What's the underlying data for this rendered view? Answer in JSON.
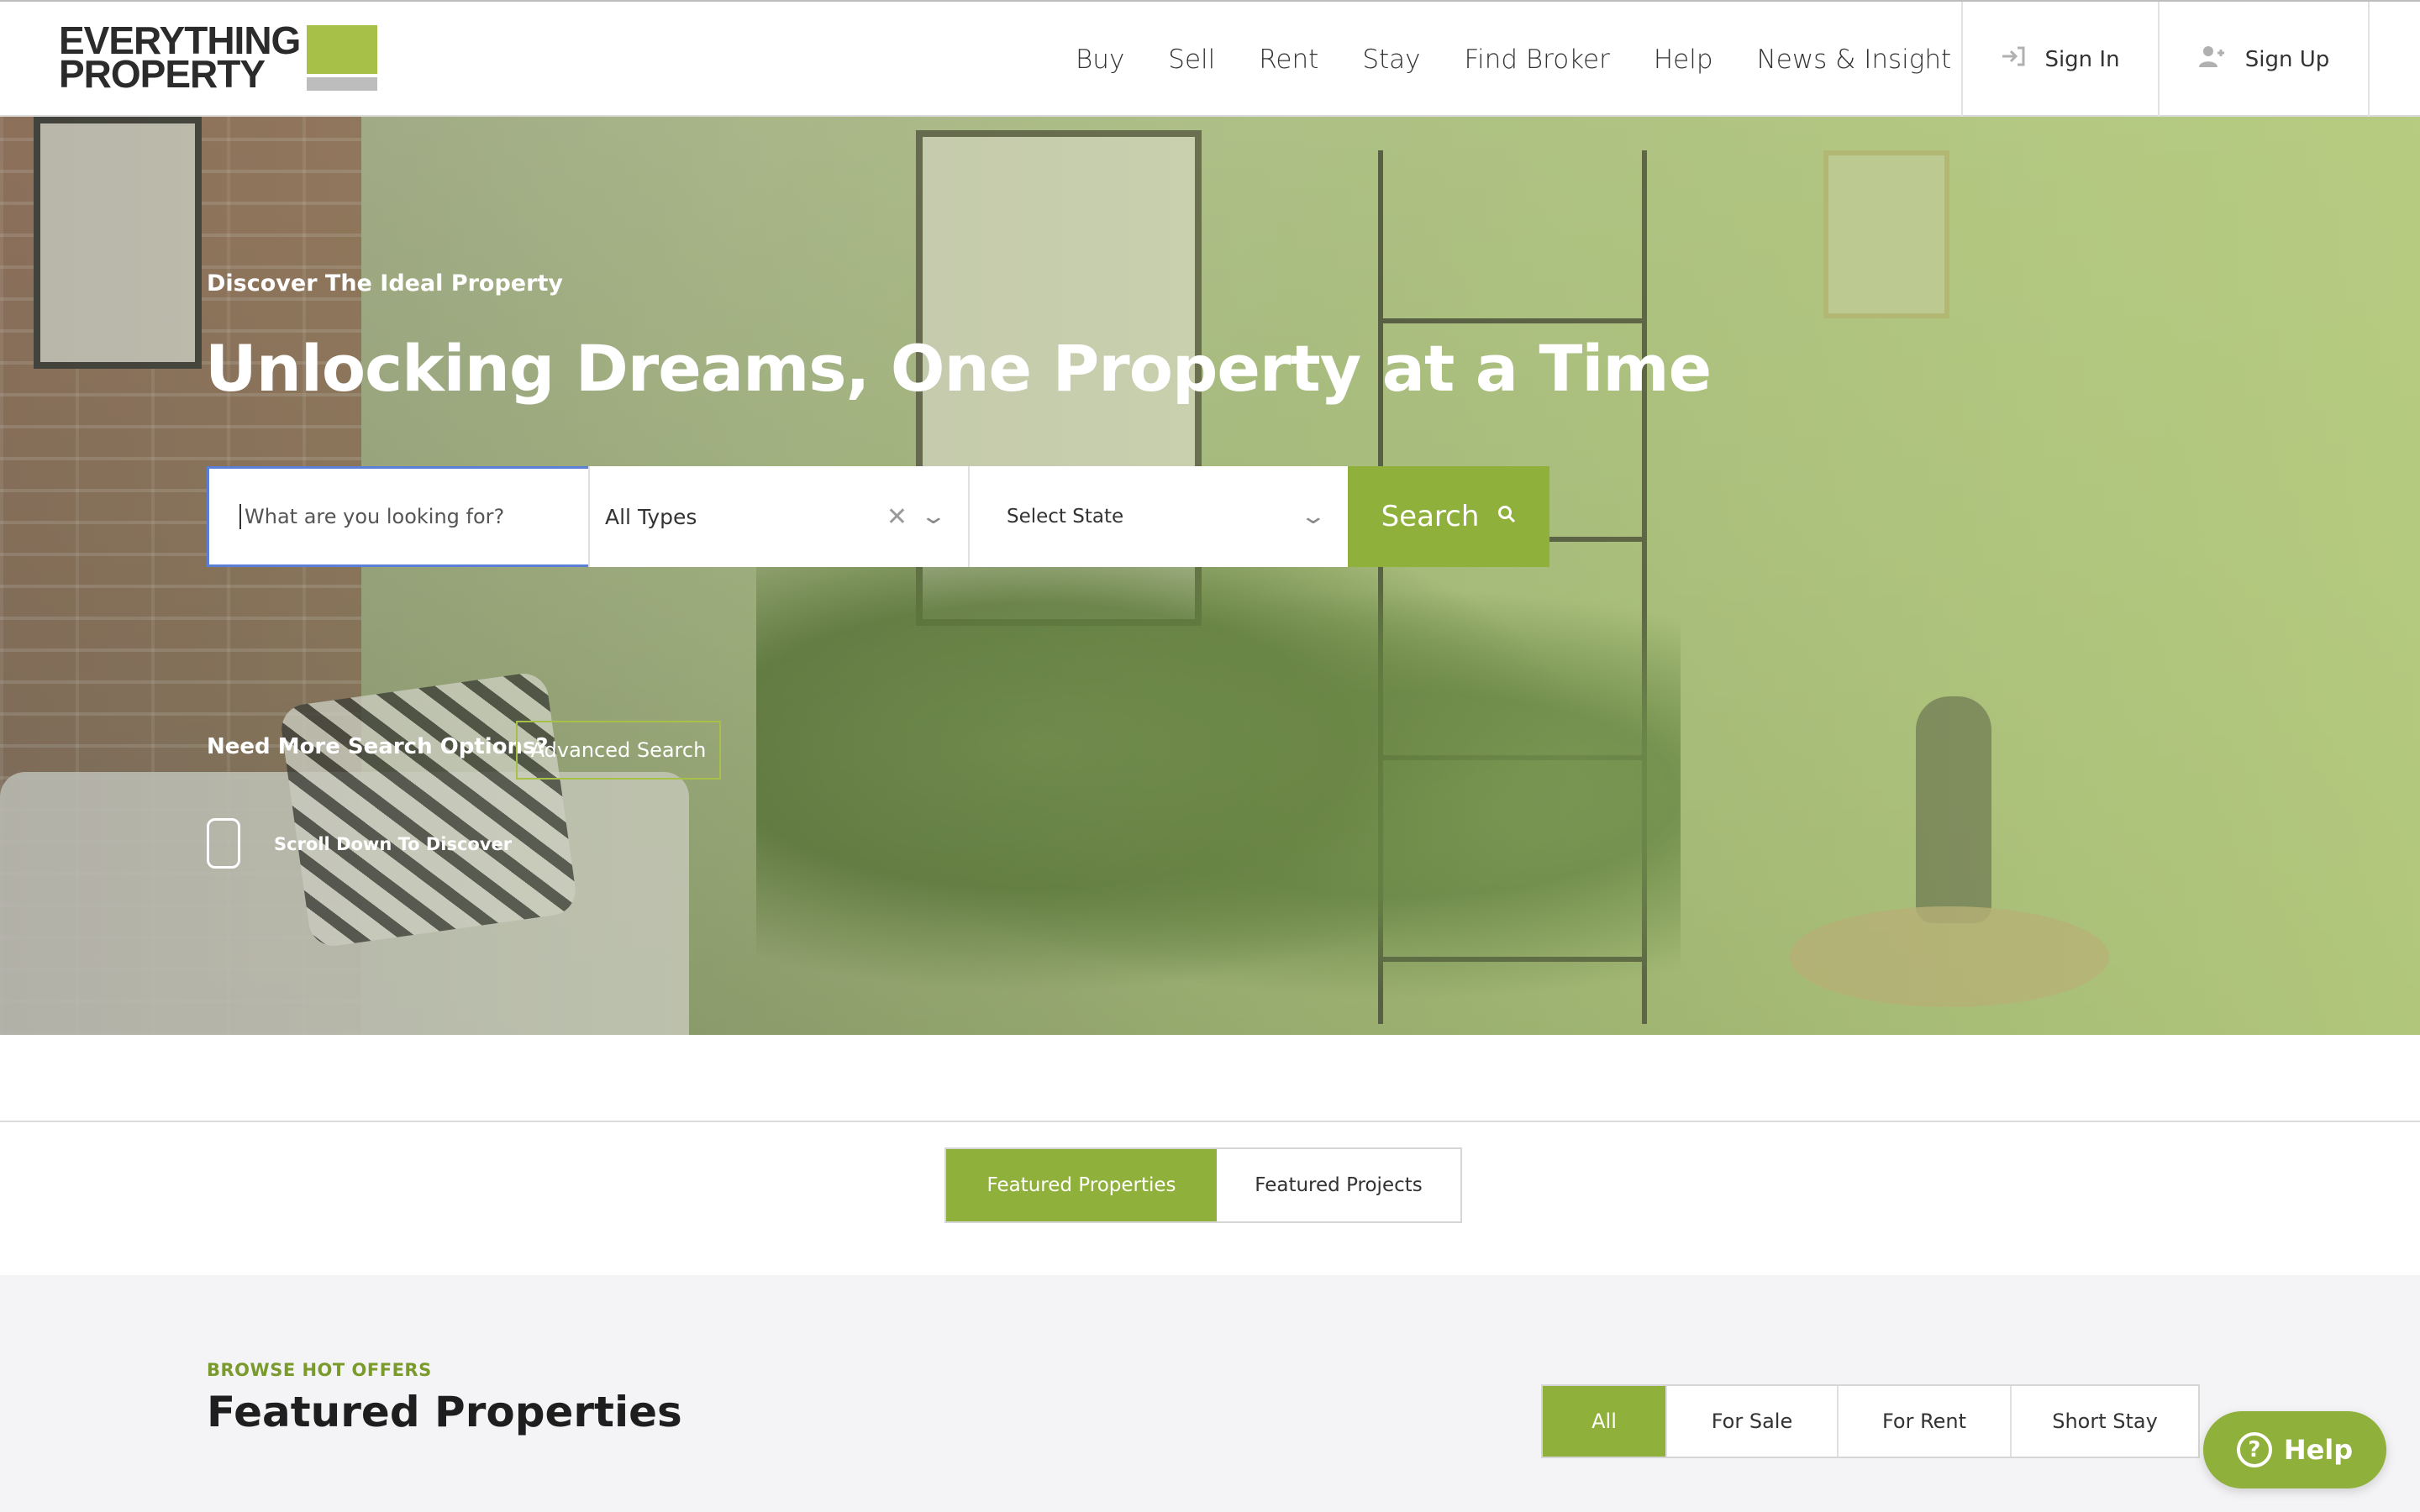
{
  "header": {
    "logo_line1": "EVERYTHING",
    "logo_line2": "PROPERTY",
    "nav": [
      "Buy",
      "Sell",
      "Rent",
      "Stay",
      "Find Broker",
      "Help",
      "News & Insight"
    ],
    "sign_in": "Sign In",
    "sign_up": "Sign Up"
  },
  "hero": {
    "eyebrow": "Discover The Ideal Property",
    "title": "Unlocking Dreams, One Property at a Time",
    "search": {
      "placeholder": "What are you looking for?",
      "types_value": "All Types",
      "state_value": "Select State",
      "button": "Search"
    },
    "more_options": "Need More Search Options?",
    "advanced_search": "Advanced Search",
    "scroll_label": "Scroll Down To Discover"
  },
  "tabs": [
    "Featured Properties",
    "Featured Projects"
  ],
  "offers": {
    "eyebrow": "BROWSE HOT OFFERS",
    "title": "Featured Properties",
    "filters": [
      "All",
      "For Sale",
      "For Rent",
      "Short Stay"
    ]
  },
  "help_button": "Help",
  "colors": {
    "brand_green": "#8fb03a",
    "logo_green": "#a6c048",
    "accent_text": "#7a9a2c"
  }
}
